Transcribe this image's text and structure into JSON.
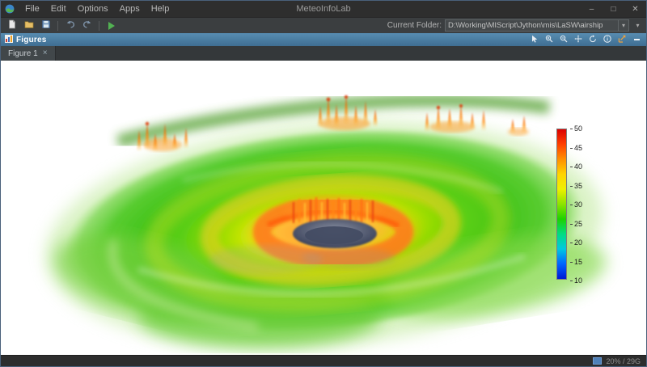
{
  "window": {
    "title": "MeteoInfoLab",
    "menu": [
      "File",
      "Edit",
      "Options",
      "Apps",
      "Help"
    ],
    "controls": {
      "minimize": "–",
      "maximize": "□",
      "close": "✕"
    }
  },
  "toolbar": {
    "current_folder_label": "Current Folder:",
    "current_folder_value": "D:\\Working\\MIScript\\Jython\\mis\\LaSW\\airship",
    "dropdown_glyph": "▾"
  },
  "figures_panel": {
    "title": "Figures"
  },
  "tabs": {
    "active_label": "Figure 1",
    "close_glyph": "×"
  },
  "chart_data": {
    "type": "heatmap",
    "subtype": "3d-volume-rendering",
    "subject": "tropical cyclone simulation with central eye, viewed in perspective",
    "colorbar": {
      "min": 10,
      "max": 50,
      "ticks_top_to_bottom": [
        "50",
        "45",
        "40",
        "35",
        "30",
        "25",
        "20",
        "15",
        "10"
      ],
      "colors_top_to_bottom": [
        "#dc0000",
        "#ff4000",
        "#ff9000",
        "#ffd400",
        "#eef000",
        "#8ce400",
        "#1ed200",
        "#00dc82",
        "#00c8e0",
        "#0064ff",
        "#0018d4"
      ]
    }
  },
  "statusbar": {
    "memory": "20% / 29G"
  }
}
